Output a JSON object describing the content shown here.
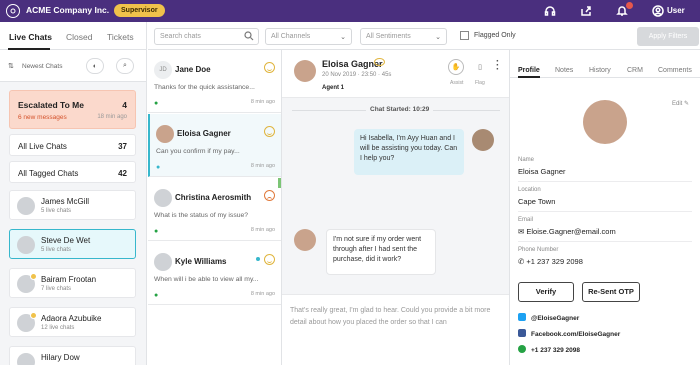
{
  "topbar": {
    "company": "ACME Company Inc.",
    "role_badge": "Supervisor",
    "user_label": "User"
  },
  "left": {
    "tabs": [
      "Live Chats",
      "Closed",
      "Tickets"
    ],
    "sort_label": "Newest Chats",
    "escalated": {
      "title": "Escalated To Me",
      "count": "4",
      "sub": "6 new messages",
      "time": "18 min ago"
    },
    "all_live": {
      "label": "All Live Chats",
      "count": "37"
    },
    "all_tagged": {
      "label": "All Tagged Chats",
      "count": "42"
    },
    "agents": [
      {
        "name": "James McGill",
        "sub": "5 live chats"
      },
      {
        "name": "Steve De Wet",
        "sub": "5 live chats"
      },
      {
        "name": "Bairam Frootan",
        "sub": "7 live chats"
      },
      {
        "name": "Adaora Azubuike",
        "sub": "12 live chats"
      },
      {
        "name": "Hilary Dow",
        "sub": ""
      }
    ]
  },
  "filters": {
    "search_placeholder": "Search chats",
    "channels": "All Channels",
    "sentiments": "All Sentiments",
    "flagged": "Flagged Only",
    "apply": "Apply Filters"
  },
  "chats": [
    {
      "initials": "JD",
      "name": "Jane Doe",
      "msg": "Thanks for the quick assistance...",
      "time": "8 min ago"
    },
    {
      "name": "Eloisa Gagner",
      "msg": "Can you confirm if my pay...",
      "time": "8 min ago"
    },
    {
      "name": "Christina Aerosmith",
      "msg": "What is the status of my issue?",
      "time": "8 min ago"
    },
    {
      "name": "Kyle Williams",
      "msg": "When will i be able to view all my...",
      "time": "8 min ago"
    }
  ],
  "conversation": {
    "name": "Eloisa Gagner",
    "date": "20 Nov 2019",
    "duration": "23:50",
    "wait": "45s",
    "agent": "Agent 1",
    "assist": "Assist",
    "flag": "Flag",
    "started": "Chat Started: 10:29",
    "msg_out": "Hi Isabella, I'm Ayy Huan and I will be assisting you today. Can I help you?",
    "msg_in": "I'm not sure if my order went through after I had sent the purchase, did it work?",
    "composer": "That's really great, I'm glad to hear. Could you provide a bit more detail about how you placed the order so that I can"
  },
  "profile": {
    "tabs": [
      "Profile",
      "Notes",
      "History",
      "CRM",
      "Comments"
    ],
    "edit": "Edit",
    "name_label": "Name",
    "name": "Eloisa Gagner",
    "location_label": "Location",
    "location": "Cape Town",
    "email_label": "Email",
    "email": "Eloise.Gagner@email.com",
    "phone_label": "Phone Number",
    "phone": "+1 237 329 2098",
    "verify": "Verify",
    "resend": "Re-Sent OTP",
    "twitter": "@EloiseGagner",
    "facebook": "Facebook.com/EloiseGagner",
    "whatsapp": "+1 237 329 2098"
  }
}
